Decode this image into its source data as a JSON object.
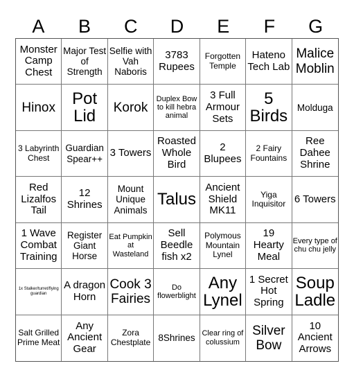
{
  "header": [
    "A",
    "B",
    "C",
    "D",
    "E",
    "F",
    "G"
  ],
  "cells": [
    [
      "Monster Camp Chest",
      "Major Test of Strength",
      "Selfie with Vah Naboris",
      "3783 Rupees",
      "Forgotten Temple",
      "Hateno Tech Lab",
      "Malice Moblin"
    ],
    [
      "Hinox",
      "Pot Lid",
      "Korok",
      "Duplex Bow to kill hebra animal",
      "3 Full Armour Sets",
      "5 Birds",
      "Molduga"
    ],
    [
      "3 Labyrinth Chest",
      "Guardian Spear++",
      "3 Towers",
      "Roasted Whole Bird",
      "2 Blupees",
      "2 Fairy Fountains",
      "Ree Dahee Shrine"
    ],
    [
      "Red Lizalfos Tail",
      "12 Shrines",
      "Mount Unique Animals",
      "Talus",
      "Ancient Shield MK11",
      "Yiga Inquisitor",
      "6 Towers"
    ],
    [
      "1 Wave Combat Training",
      "Register Giant Horse",
      "Eat Pumpkin at Wasteland",
      "Sell Beedle fish x2",
      "Polymous Mountain Lynel",
      "19 Hearty Meal",
      "Every type of chu chu jelly"
    ],
    [
      "1x Stalker/turret/flying guardian",
      "A dragon Horn",
      "Cook 3 Fairies",
      "Do flowerblight",
      "Any Lynel",
      "1 Secret Hot Spring",
      "Soup Ladle"
    ],
    [
      "Salt Grilled Prime Meat",
      "Any Ancient Gear",
      "Zora Chestplate",
      "8Shrines",
      "Clear ring of colussium",
      "Silver Bow",
      "10 Ancient Arrows"
    ]
  ]
}
